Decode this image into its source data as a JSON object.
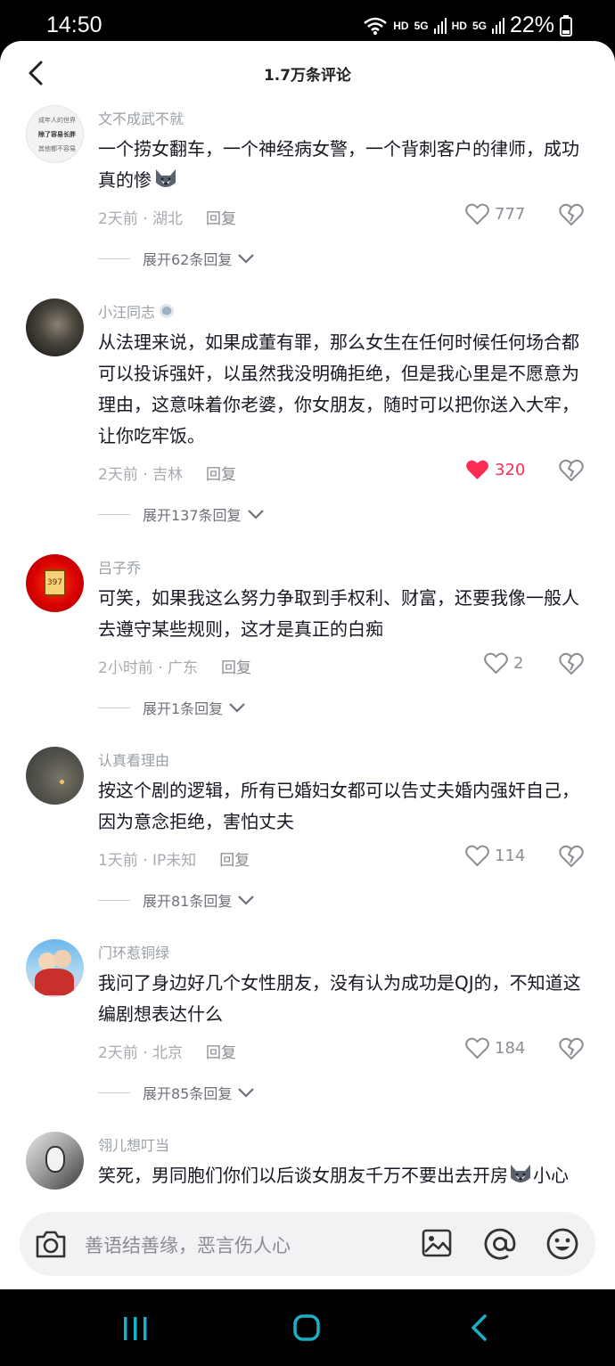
{
  "status_bar": {
    "time": "14:50",
    "hd1": "HD",
    "net1": "5G",
    "hd2": "HD",
    "net2": "5G",
    "battery": "22%"
  },
  "header": {
    "title": "1.7万条评论"
  },
  "comments": [
    {
      "username": "文不成武不就",
      "avatar_text": [
        "成年人的世界",
        "除了容易长胖",
        "其他都不容易"
      ],
      "text": "一个捞女翻车，一个神经病女警，一个背刺客户的律师，成功真的惨",
      "emoji": "husky-emoji",
      "time_location": "2天前 · 湖北",
      "reply": "回复",
      "likes": "777",
      "liked": false,
      "expand": "展开62条回复"
    },
    {
      "username": "小汪同志",
      "badge": "badge-icon",
      "text": "从法理来说，如果成董有罪，那么女生在任何时候任何场合都可以投诉强奸，以虽然我没明确拒绝，但是我心里是不愿意为理由，这意味着你老婆，你女朋友，随时可以把你送入大牢，让你吃牢饭。",
      "time_location": "2天前 · 吉林",
      "reply": "回复",
      "likes": "320",
      "liked": true,
      "expand": "展开137条回复"
    },
    {
      "username": "吕子乔",
      "avatar_text": [
        "397"
      ],
      "text": "可笑，如果我这么努力争取到手权利、财富，还要我像一般人去遵守某些规则，这才是真正的白痴",
      "time_location": "2小时前 · 广东",
      "reply": "回复",
      "likes": "2",
      "liked": false,
      "expand": "展开1条回复"
    },
    {
      "username": "认真看理由",
      "text": "按这个剧的逻辑，所有已婚妇女都可以告丈夫婚内强奸自己，因为意念拒绝，害怕丈夫",
      "time_location": "1天前 · IP未知",
      "reply": "回复",
      "likes": "114",
      "liked": false,
      "expand": "展开81条回复"
    },
    {
      "username": "门环惹铜绿",
      "text": "我问了身边好几个女性朋友，没有认为成功是QJ的，不知道这编剧想表达什么",
      "time_location": "2天前 · 北京",
      "reply": "回复",
      "likes": "184",
      "liked": false,
      "expand": "展开85条回复"
    },
    {
      "username": "翎儿想叮当",
      "text_before_emoji": "笑死，男同胞们你们以后谈女朋友千万不要出去开房",
      "emoji": "husky-emoji",
      "text_after_emoji": "小心"
    }
  ],
  "input_bar": {
    "placeholder": "善语结善缘，恶言伤人心",
    "icons": [
      "camera-icon",
      "image-icon",
      "at-icon",
      "emoji-icon"
    ]
  },
  "nav_bar": {
    "icons": [
      "recent-apps-icon",
      "home-icon",
      "back-icon"
    ]
  },
  "colors": {
    "like_active": "#fe2c55",
    "text": "#161823",
    "meta": "#a8abb1"
  }
}
